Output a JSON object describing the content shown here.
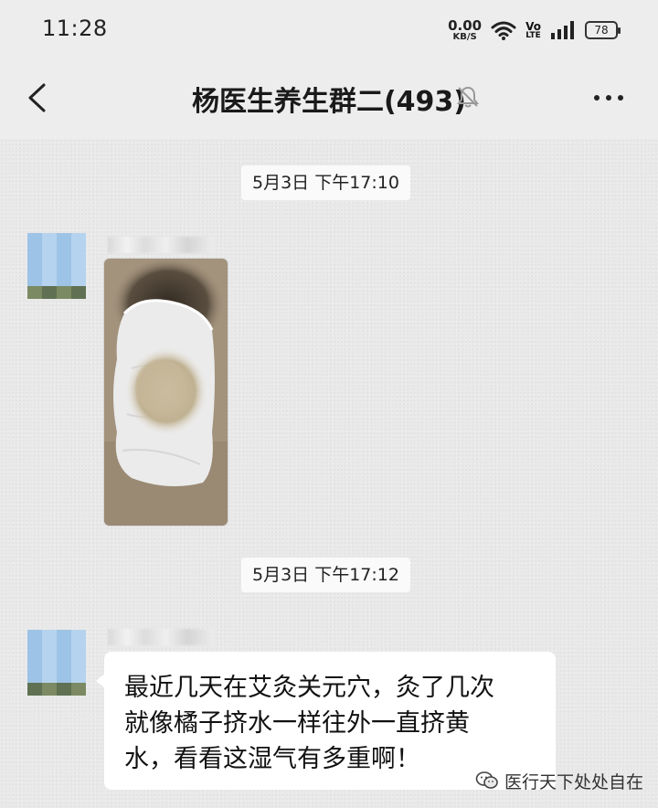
{
  "status_bar": {
    "time": "11:28",
    "net_speed_value": "0.00",
    "net_speed_unit": "KB/S",
    "volte_top": "Vo",
    "volte_bottom": "LTE",
    "battery": "78"
  },
  "header": {
    "title": "杨医生养生群二(493)",
    "back_icon": "chevron-left-icon",
    "mute_icon": "bell-muted-icon",
    "more_icon": "more-dots-icon"
  },
  "messages": [
    {
      "type": "timestamp",
      "text": "5月3日 下午17:10"
    },
    {
      "type": "image",
      "image_desc": "photo-of-used-moxibustion-patch"
    },
    {
      "type": "timestamp",
      "text": "5月3日 下午17:12"
    },
    {
      "type": "text",
      "lines": [
        "最近几天在艾灸关元穴，灸了几次",
        "就像橘子挤水一样往外一直挤黄",
        "水，看看这湿气有多重啊！"
      ]
    }
  ],
  "watermark": {
    "text": "医行天下处处自在",
    "icon": "wechat-icon"
  }
}
